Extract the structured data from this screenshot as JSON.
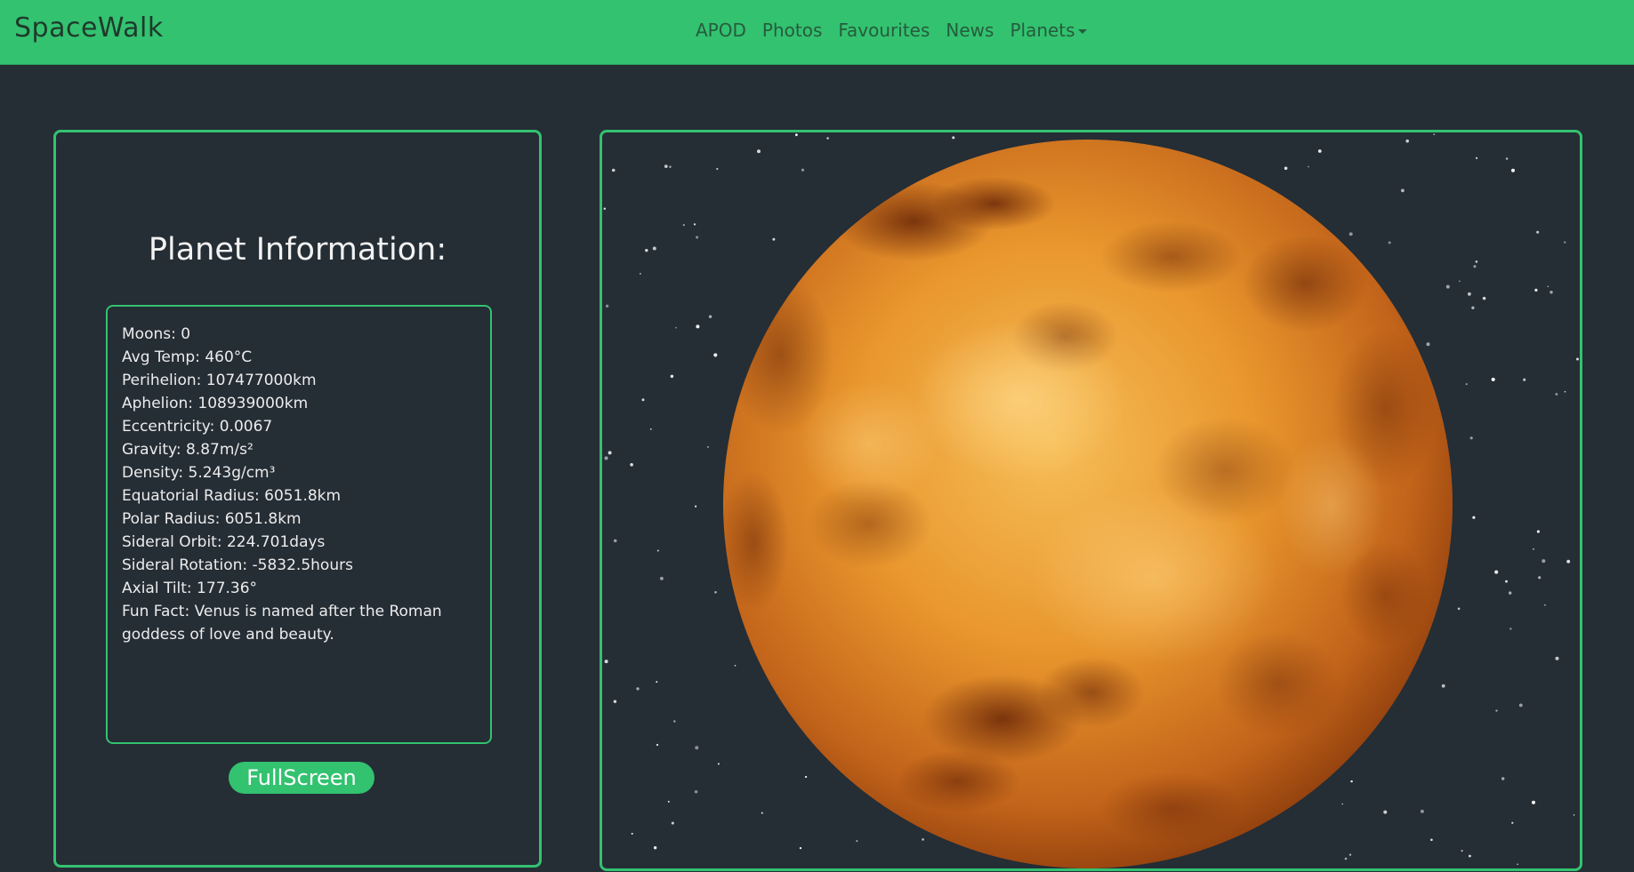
{
  "brand": "SpaceWalk",
  "nav": {
    "items": [
      "APOD",
      "Photos",
      "Favourites",
      "News"
    ],
    "planets_label": "Planets"
  },
  "info": {
    "title": "Planet Information:",
    "moons": "Moons: 0",
    "avg_temp": "Avg Temp: 460°C",
    "perihelion": "Perihelion: 107477000km",
    "aphelion": "Aphelion: 108939000km",
    "eccentricity": "Eccentricity: 0.0067",
    "gravity": "Gravity: 8.87m/s²",
    "density": "Density: 5.243g/cm³",
    "equatorial_radius": "Equatorial Radius: 6051.8km",
    "polar_radius": "Polar Radius: 6051.8km",
    "sideral_orbit": "Sideral Orbit: 224.701days",
    "sideral_rotation": "Sideral Rotation: -5832.5hours",
    "axial_tilt": "Axial Tilt: 177.36°",
    "fun_fact": "Fun Fact: Venus is named after the Roman goddess of love and beauty."
  },
  "fullscreen_label": "FullScreen",
  "colors": {
    "accent": "#33c270",
    "background": "#252d35",
    "planet_light": "#f2a93b",
    "planet_dark": "#8a3a0c"
  }
}
